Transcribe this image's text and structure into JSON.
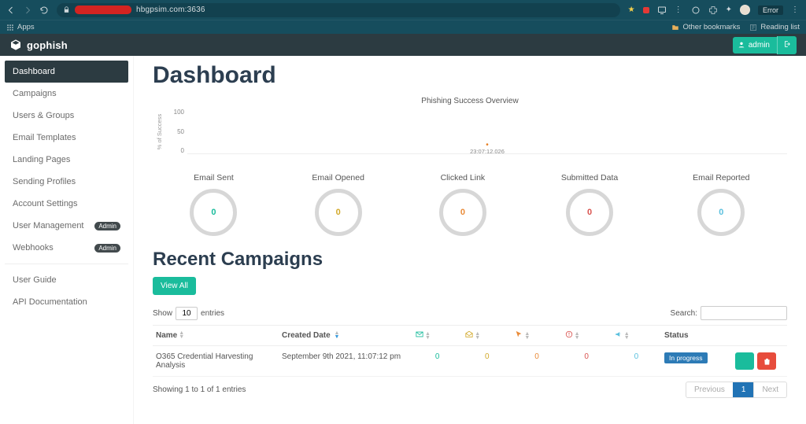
{
  "browser": {
    "url_suffix": "hbgpsim.com:3636",
    "apps_label": "Apps",
    "other_bookmarks": "Other bookmarks",
    "reading_list": "Reading list",
    "error_label": "Error"
  },
  "admin": {
    "label": "admin"
  },
  "brand": "gophish",
  "sidebar": {
    "items": [
      {
        "label": "Dashboard",
        "active": true,
        "badge": null
      },
      {
        "label": "Campaigns",
        "active": false,
        "badge": null
      },
      {
        "label": "Users & Groups",
        "active": false,
        "badge": null
      },
      {
        "label": "Email Templates",
        "active": false,
        "badge": null
      },
      {
        "label": "Landing Pages",
        "active": false,
        "badge": null
      },
      {
        "label": "Sending Profiles",
        "active": false,
        "badge": null
      },
      {
        "label": "Account Settings",
        "active": false,
        "badge": null
      },
      {
        "label": "User Management",
        "active": false,
        "badge": "Admin"
      },
      {
        "label": "Webhooks",
        "active": false,
        "badge": "Admin"
      }
    ],
    "secondary": [
      {
        "label": "User Guide"
      },
      {
        "label": "API Documentation"
      }
    ]
  },
  "page": {
    "title": "Dashboard",
    "chart_title": "Phishing Success Overview",
    "y_axis_label": "% of Success",
    "y_ticks": [
      "100",
      "50",
      "0"
    ],
    "data_point_label": "23:07:12.026"
  },
  "chart_data": {
    "type": "line",
    "title": "Phishing Success Overview",
    "xlabel": "",
    "ylabel": "% of Success",
    "ylim": [
      0,
      100
    ],
    "series": [
      {
        "name": "% of Success",
        "points": [
          {
            "x": "23:07:12.026",
            "y": 0
          }
        ]
      }
    ]
  },
  "stats": [
    {
      "label": "Email Sent",
      "value": "0",
      "color": "c-teal"
    },
    {
      "label": "Email Opened",
      "value": "0",
      "color": "c-yellow"
    },
    {
      "label": "Clicked Link",
      "value": "0",
      "color": "c-orange"
    },
    {
      "label": "Submitted Data",
      "value": "0",
      "color": "c-red"
    },
    {
      "label": "Email Reported",
      "value": "0",
      "color": "c-blue"
    }
  ],
  "recent": {
    "heading": "Recent Campaigns",
    "view_all": "View All",
    "show_label_pre": "Show",
    "show_label_post": "entries",
    "show_value": "10",
    "search_label": "Search:",
    "columns": {
      "name": "Name",
      "created": "Created Date",
      "status": "Status"
    },
    "rows": [
      {
        "name": "O365 Credential Harvesting Analysis",
        "created": "September 9th 2021, 11:07:12 pm",
        "sent": "0",
        "opened": "0",
        "clicked": "0",
        "submitted": "0",
        "reported": "0",
        "status": "In progress"
      }
    ],
    "footer": "Showing 1 to 1 of 1 entries",
    "pager": {
      "previous": "Previous",
      "current": "1",
      "next": "Next"
    }
  }
}
